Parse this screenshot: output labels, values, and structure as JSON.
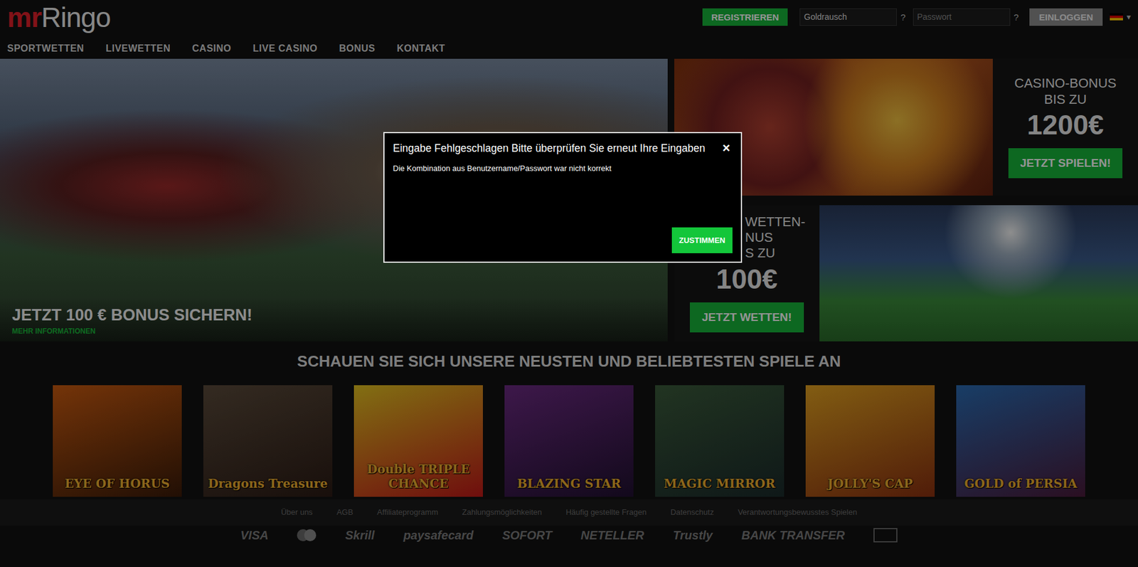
{
  "logo": {
    "prefix": "mr",
    "name": "Ringo"
  },
  "header": {
    "register": "REGISTRIEREN",
    "username": {
      "value": "Goldrausch",
      "help": "?"
    },
    "password": {
      "placeholder": "Passwort",
      "help": "?"
    },
    "login": "EINLOGGEN",
    "language": {
      "caret": "▾"
    }
  },
  "nav": [
    "SPORTWETTEN",
    "LIVEWETTEN",
    "CASINO",
    "LIVE CASINO",
    "BONUS",
    "KONTAKT"
  ],
  "hero": {
    "headline": "JETZT 100 € BONUS SICHERN!",
    "link": "MEHR INFORMATIONEN"
  },
  "casino_promo": {
    "lines": [
      "CASINO-BONUS",
      "BIS ZU"
    ],
    "amount": "1200€",
    "button": "JETZT SPIELEN!"
  },
  "sport_promo": {
    "lines": [
      "WETTEN-",
      "NUS",
      "S ZU"
    ],
    "amount": "100€",
    "button": "JETZT WETTEN!"
  },
  "games": {
    "title": "SCHAUEN SIE SICH UNSERE NEUSTEN UND BELIEBTESTEN SPIELE AN",
    "items": [
      "EYE OF HORUS",
      "Dragons Treasure",
      "Double TRIPLE CHANCE",
      "BLAZING STAR",
      "MAGIC MIRROR",
      "JOLLY'S CAP",
      "GOLD of PERSIA"
    ]
  },
  "footer": {
    "links": [
      "Über uns",
      "AGB",
      "Affiliateprogramm",
      "Zahlungsmöglichkeiten",
      "Häufig gestellte Fragen",
      "Datenschutz",
      "Verantwortungsbewusstes Spielen"
    ],
    "payments": [
      {
        "kind": "text",
        "label": "VISA"
      },
      {
        "kind": "circles"
      },
      {
        "kind": "text",
        "label": "Skrill"
      },
      {
        "kind": "text",
        "label": "paysafecard"
      },
      {
        "kind": "text",
        "label": "SOFORT"
      },
      {
        "kind": "text",
        "label": "NETELLER"
      },
      {
        "kind": "text",
        "label": "Trustly"
      },
      {
        "kind": "text",
        "label": "BANK TRANSFER"
      },
      {
        "kind": "badge"
      }
    ]
  },
  "dialog": {
    "title": "Eingabe Fehlgeschlagen Bitte überprüfen Sie erneut Ihre Eingaben",
    "close": "×",
    "message": "Die Kombination aus Benutzername/Passwort war nicht korrekt",
    "button": "ZUSTIMMEN"
  }
}
